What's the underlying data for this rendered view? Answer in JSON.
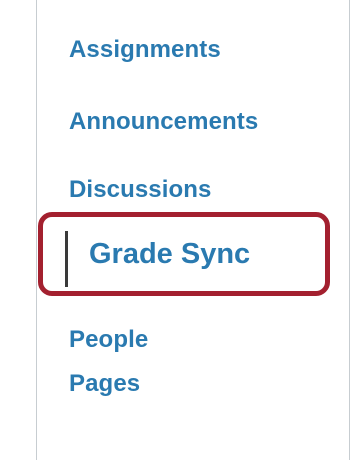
{
  "course_nav": {
    "items": [
      {
        "label": "Assignments"
      },
      {
        "label": "Announcements"
      },
      {
        "label": "Discussions"
      },
      {
        "label": "Grade Sync",
        "active": true
      },
      {
        "label": "People"
      },
      {
        "label": "Pages"
      }
    ]
  },
  "colors": {
    "link": "#2a7ab0",
    "highlight_border": "#a3202f",
    "active_indicator": "#3a3a3a",
    "panel_border": "#c7cdd1"
  }
}
